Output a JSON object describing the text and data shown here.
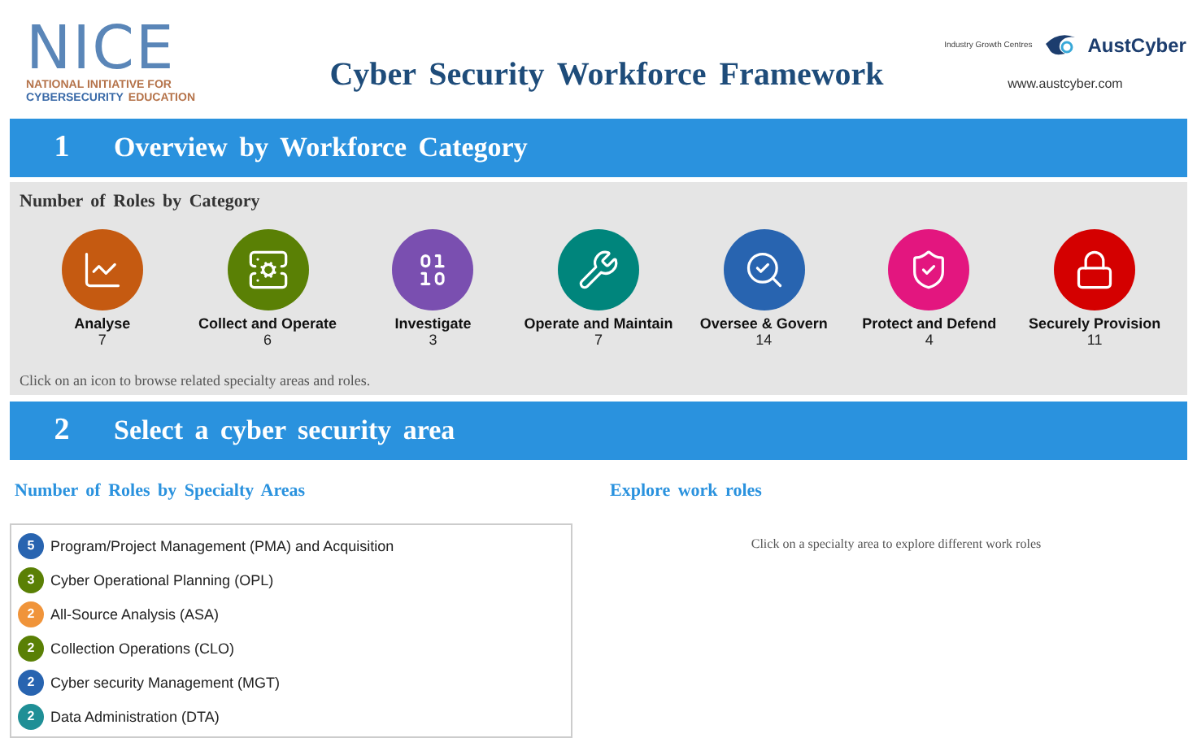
{
  "header": {
    "logo": {
      "name": "NICE",
      "line_1": "NATIONAL INITIATIVE FOR",
      "line_2_a": "CYBERSECURITY",
      "line_2_b": "EDUCATION"
    },
    "title": "Cyber Security Workforce Framework",
    "partner": {
      "caption": "Industry Growth Centres",
      "brand": "AustCyber",
      "url": "www.austcyber.com"
    }
  },
  "section_1": {
    "number": "1",
    "title": "Overview by Workforce Category",
    "heading": "Number of Roles by Category",
    "hint": "Click on an icon to browse related specialty areas and roles.",
    "categories": [
      {
        "kind": "chart",
        "name": "Analyse",
        "count": "7",
        "color": "#c55a11"
      },
      {
        "kind": "server",
        "name": "Collect and Operate",
        "count": "6",
        "color": "#5a8005"
      },
      {
        "kind": "binary",
        "name": "Investigate",
        "count": "3",
        "color": "#7a4fb0"
      },
      {
        "kind": "tools",
        "name": "Operate and Maintain",
        "count": "7",
        "color": "#00857c"
      },
      {
        "kind": "inspect",
        "name": "Oversee & Govern",
        "count": "14",
        "color": "#2864b0"
      },
      {
        "kind": "shield",
        "name": "Protect and Defend",
        "count": "4",
        "color": "#e3167f"
      },
      {
        "kind": "lock",
        "name": "Securely Provision",
        "count": "11",
        "color": "#d40000"
      }
    ]
  },
  "section_2": {
    "number": "2",
    "title": "Select a cyber security area",
    "specialty_heading": "Number of Roles by Specialty Areas",
    "explore_heading": "Explore work roles",
    "explore_hint": "Click on a specialty area to explore different work roles",
    "specialty_areas": [
      {
        "count": "5",
        "name": "Program/Project Management (PMA) and Acquisition",
        "color": "#2864b0"
      },
      {
        "count": "3",
        "name": "Cyber Operational Planning (OPL)",
        "color": "#5a8005"
      },
      {
        "count": "2",
        "name": "All-Source Analysis (ASA)",
        "color": "#f0943a"
      },
      {
        "count": "2",
        "name": "Collection Operations (CLO)",
        "color": "#5a8005"
      },
      {
        "count": "2",
        "name": "Cyber security Management (MGT)",
        "color": "#2864b0"
      },
      {
        "count": "2",
        "name": "Data Administration (DTA)",
        "color": "#1f8f96"
      }
    ]
  }
}
